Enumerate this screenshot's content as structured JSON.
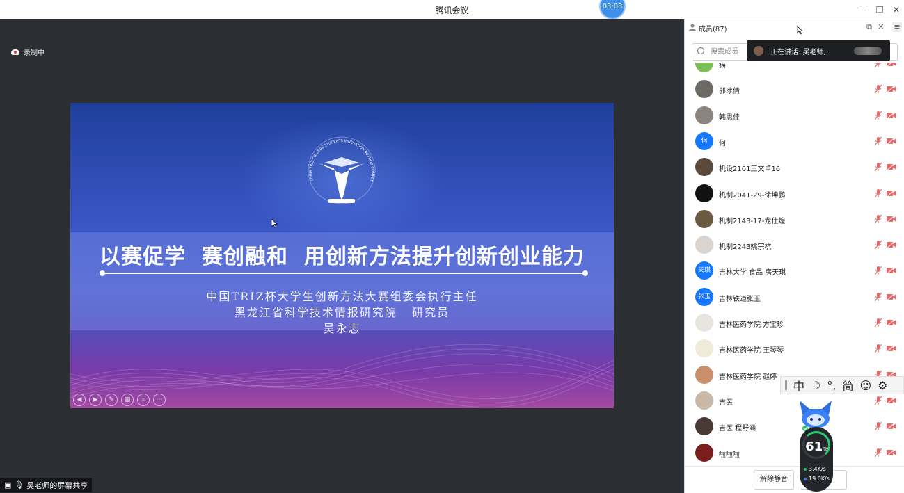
{
  "window": {
    "title": "腾讯会议",
    "timer": "03:03",
    "minimize": "—",
    "restore": "❐",
    "close": "✕"
  },
  "recording": {
    "label": "录制中"
  },
  "slide": {
    "headline": "以赛促学  赛创融和  用创新方法提升创新创业能力",
    "subtitle_line1": "中国TRIZ杯大学生创新方法大赛组委会执行主任",
    "subtitle_line2": "黑龙江省科学技术情报研究院   研究员",
    "subtitle_line3": "吴永志",
    "logo_ring_text": "CHINA TRIZ COLLEGE STUDENTS INNOVATION METHOD COMPETITION",
    "controls": [
      "◀",
      "▶",
      "✎",
      "▦",
      "⌕",
      "⋯"
    ]
  },
  "share_label": "吴老师的屏幕共享",
  "sidebar": {
    "members_title": "成员(87)",
    "search_placeholder": "搜索成员",
    "speaking_text": "正在讲话: 吴老师;",
    "members": [
      {
        "name": "猫",
        "avatar_text": "",
        "avatar_color": "#7fbf5a"
      },
      {
        "name": "郭冰倩",
        "avatar_text": "",
        "avatar_color": "#6d6a66"
      },
      {
        "name": "韩思佳",
        "avatar_text": "",
        "avatar_color": "#8a8580"
      },
      {
        "name": "何",
        "avatar_text": "何",
        "avatar_color": "#1677ff"
      },
      {
        "name": "机设2101王文卓16",
        "avatar_text": "",
        "avatar_color": "#5a4a3e"
      },
      {
        "name": "机制2041-29-徐坤鹏",
        "avatar_text": "",
        "avatar_color": "#111111"
      },
      {
        "name": "机制2143-17-龙仕煌",
        "avatar_text": "",
        "avatar_color": "#6b5a42"
      },
      {
        "name": "机制2243姚宗杭",
        "avatar_text": "",
        "avatar_color": "#d9d4cf"
      },
      {
        "name": "吉林大学 食品 房天琪",
        "avatar_text": "天琪",
        "avatar_color": "#1677ff"
      },
      {
        "name": "吉林铁道张玉",
        "avatar_text": "张玉",
        "avatar_color": "#1677ff"
      },
      {
        "name": "吉林医药学院 方宝珍",
        "avatar_text": "",
        "avatar_color": "#e8e4e0"
      },
      {
        "name": "吉林医药学院 王琴琴",
        "avatar_text": "",
        "avatar_color": "#f0ead8"
      },
      {
        "name": "吉林医药学院 赵婷",
        "avatar_text": "",
        "avatar_color": "#c98f6a"
      },
      {
        "name": "吉医",
        "avatar_text": "",
        "avatar_color": "#c8b9a6"
      },
      {
        "name": "吉医 程舒涵",
        "avatar_text": "",
        "avatar_color": "#4a3a36"
      },
      {
        "name": "啦啦啦",
        "avatar_text": "",
        "avatar_color": "#7a1e1e"
      }
    ],
    "unmute_all": "解除静音"
  },
  "ime": {
    "items": [
      "中",
      "☽",
      "°,",
      "简",
      "☺",
      "⚙"
    ]
  },
  "net_monitor": {
    "percent": "61",
    "percent_unit": "%",
    "upload": "3.4K/s",
    "download": "19.0K/s"
  },
  "colors": {
    "accent": "#1677ff",
    "muted_red": "#e06a6a"
  }
}
